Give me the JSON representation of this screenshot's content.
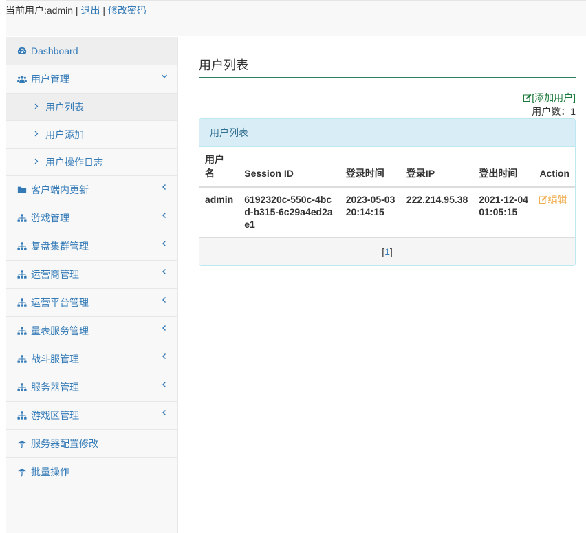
{
  "topbar": {
    "current_user_prefix": "当前用户:admin",
    "sep1": " | ",
    "logout": "退出",
    "sep2": " | ",
    "change_password": "修改密码"
  },
  "sidebar": {
    "items": [
      {
        "label": "Dashboard",
        "icon": "dashboard-icon"
      },
      {
        "label": "用户管理",
        "icon": "users-icon",
        "expanded": true,
        "children": [
          {
            "label": "用户列表",
            "active": true
          },
          {
            "label": "用户添加"
          },
          {
            "label": "用户操作日志"
          }
        ]
      },
      {
        "label": "客户端内更新",
        "icon": "folder-icon"
      },
      {
        "label": "游戏管理",
        "icon": "sitemap-icon"
      },
      {
        "label": "复盘集群管理",
        "icon": "sitemap-icon"
      },
      {
        "label": "运营商管理",
        "icon": "sitemap-icon"
      },
      {
        "label": "运营平台管理",
        "icon": "sitemap-icon"
      },
      {
        "label": "量表服务管理",
        "icon": "sitemap-icon"
      },
      {
        "label": "战斗服管理",
        "icon": "sitemap-icon"
      },
      {
        "label": "服务器管理",
        "icon": "sitemap-icon"
      },
      {
        "label": "游戏区管理",
        "icon": "sitemap-icon"
      },
      {
        "label": "服务器配置修改",
        "icon": "umbrella-icon"
      },
      {
        "label": "批量操作",
        "icon": "umbrella-icon"
      }
    ]
  },
  "main": {
    "title": "用户列表",
    "add_user": "[添加用户]",
    "user_count": "用户数：1",
    "panel_title": "用户列表",
    "columns": [
      "用户名",
      "Session ID",
      "登录时间",
      "登录IP",
      "登出时间",
      "Action"
    ],
    "rows": [
      {
        "username": "admin",
        "session_id": "6192320c-550c-4bcd-b315-6c29a4ed2ae1",
        "login_time": "2023-05-03 20:14:15",
        "login_ip": "222.214.95.38",
        "logout_time": "2021-12-04 01:05:15",
        "action": "编辑"
      }
    ],
    "pagination": {
      "open": "[",
      "page": "1",
      "close": "]"
    }
  },
  "colors": {
    "link": "#337ab7",
    "panel_heading_bg": "#d9edf7",
    "panel_heading_text": "#31708f",
    "add_user": "#1a7a3a",
    "edit_action": "#f0ad4e"
  }
}
